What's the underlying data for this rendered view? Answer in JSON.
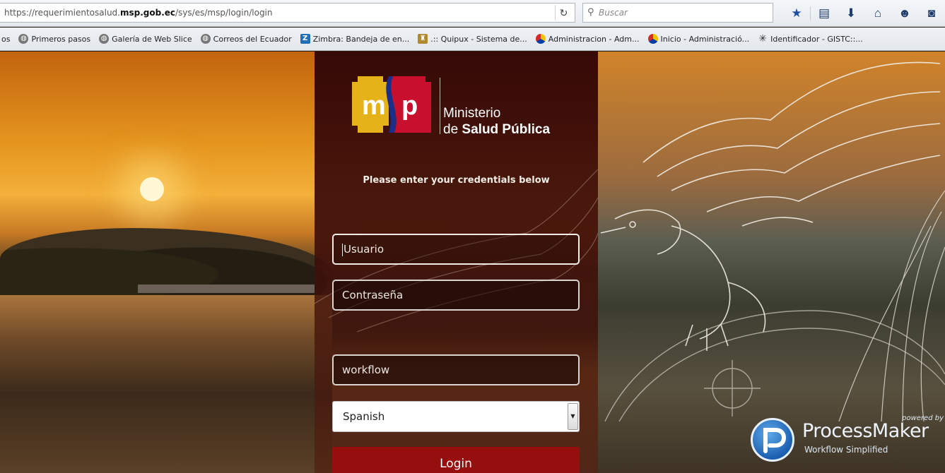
{
  "browser": {
    "url_prefix": "https://requerimientosalud.",
    "url_domain": "msp.gob.ec",
    "url_path": "/sys/es/msp/login/login",
    "reload_icon": "reload-icon",
    "search_placeholder": "Buscar",
    "toolbar_icons": [
      "bookmark-star-icon",
      "reading-list-icon",
      "download-icon",
      "home-icon",
      "hello-chat-icon",
      "pocket-icon"
    ]
  },
  "bookmarks": [
    {
      "label": "os",
      "icon": "none"
    },
    {
      "label": "Primeros pasos",
      "icon": "globe-icon"
    },
    {
      "label": "Galería de Web Slice",
      "icon": "globe-icon"
    },
    {
      "label": "Correos del Ecuador",
      "icon": "globe-icon"
    },
    {
      "label": "Zimbra: Bandeja de en...",
      "icon": "zimbra-icon"
    },
    {
      "label": ".:: Quipux - Sistema de...",
      "icon": "quipux-icon"
    },
    {
      "label": "Administracion - Adm...",
      "icon": "admin-icon"
    },
    {
      "label": "Inicio - Administració...",
      "icon": "admin-icon"
    },
    {
      "label": "Identificador - GISTC::...",
      "icon": "identifier-icon"
    }
  ],
  "logo": {
    "mark_text": "msp",
    "line1": "Ministerio",
    "line2_prefix": "de ",
    "line2_bold": "Salud Pública"
  },
  "login": {
    "prompt": "Please enter your credentials below",
    "username_placeholder": "Usuario",
    "password_placeholder": "Contraseña",
    "workspace_value": "workflow",
    "language_selected": "Spanish",
    "submit_label": "Login"
  },
  "footer_badge": {
    "powered_by": "powered by",
    "name": "ProcessMaker",
    "tagline": "Workflow Simplified"
  },
  "colors": {
    "panel_bg": "#3a0a08",
    "login_button": "#960e0e",
    "logo_yellow": "#e5b21a",
    "logo_red": "#c8102e",
    "logo_blue": "#1a2f8a"
  }
}
